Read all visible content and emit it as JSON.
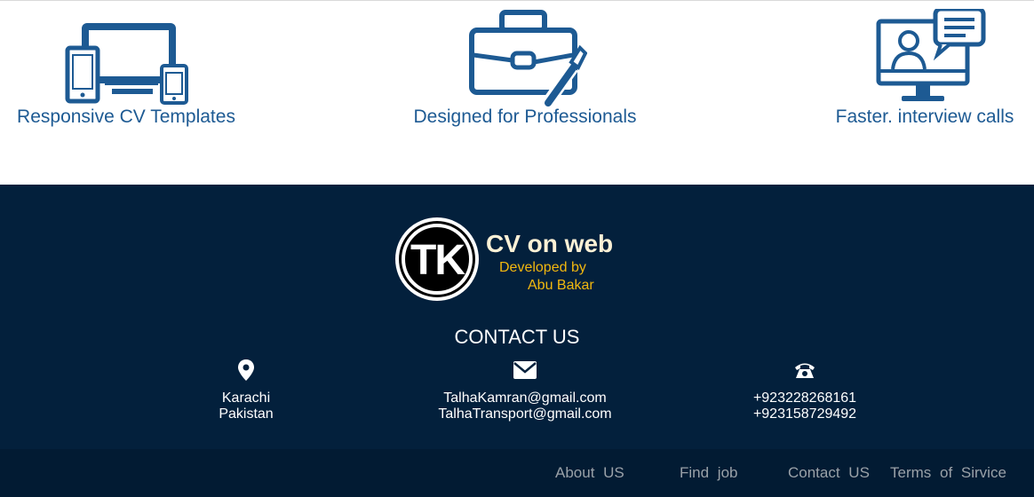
{
  "features": [
    {
      "label": "Responsive CV Templates",
      "icon": "devices-icon"
    },
    {
      "label": "Designed for Professionals",
      "icon": "briefcase-brush-icon"
    },
    {
      "label": "Faster. interview calls",
      "icon": "video-interview-icon"
    }
  ],
  "brand": {
    "logo_text": "TK",
    "title": "CV on web",
    "developed_by": "Developed by",
    "developer": "Abu Bakar"
  },
  "contact": {
    "title": "CONTACT US",
    "location": {
      "line1": "Karachi",
      "line2": "Pakistan",
      "icon": "location-pin-icon"
    },
    "email": {
      "line1": "TalhaKamran@gmail.com",
      "line2": "TalhaTransport@gmail.com",
      "icon": "envelope-icon"
    },
    "phone": {
      "line1": "+923228268161",
      "line2": "+923158729492",
      "icon": "telephone-icon"
    }
  },
  "nav": {
    "about": "About US",
    "find_job": "Find job",
    "contact": "Contact US",
    "terms": "Terms of Sirvice"
  },
  "colors": {
    "feature_blue": "#1d5a93",
    "footer_bg": "#03203c",
    "bottom_bar_bg": "#021b33",
    "brand_gold": "#f2b80f",
    "brand_title": "#fdf1d6"
  }
}
